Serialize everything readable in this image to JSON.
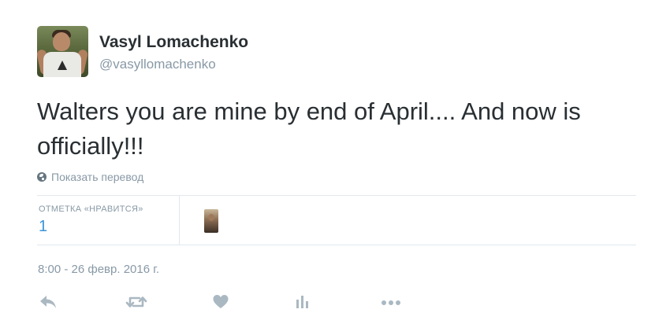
{
  "author": {
    "name": "Vasyl Lomachenko",
    "handle": "@vasyllomachenko"
  },
  "tweet": {
    "text": "Walters you are mine by end of April.... And now is officially!!!",
    "translate_label": "Показать перевод"
  },
  "stats": {
    "likes_label": "ОТМЕТКА «НРАВИТСЯ»",
    "likes_count": "1"
  },
  "timestamp": "8:00 - 26 февр. 2016 г.",
  "actions": {
    "icons": [
      "reply-icon",
      "retweet-icon",
      "like-icon",
      "analytics-icon",
      "more-icon"
    ],
    "icon_color": "#aab8c2"
  },
  "colors": {
    "link": "#3b94d9",
    "muted": "#8899a6",
    "text": "#292f33",
    "divider": "#e1e8ed"
  }
}
